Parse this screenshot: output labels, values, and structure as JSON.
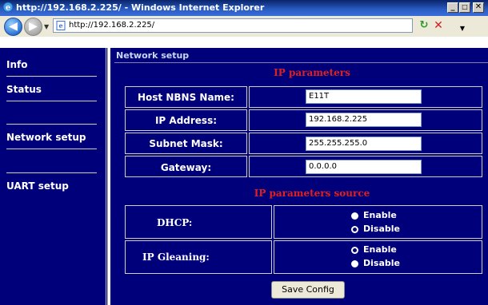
{
  "window": {
    "title": "http://192.168.2.225/ - Windows Internet Explorer",
    "address": "http://192.168.2.225/",
    "controls": {
      "minimize": "_",
      "maximize": "□",
      "close": "✕"
    }
  },
  "sidebar": {
    "items": [
      {
        "label": "Info"
      },
      {
        "label": "Status"
      },
      {
        "label": "Network setup"
      },
      {
        "label": "UART setup"
      }
    ]
  },
  "main": {
    "section_title": "Network setup",
    "ip_parameters": {
      "heading": "IP parameters",
      "rows": [
        {
          "label": "Host NBNS Name:",
          "value": "E11T"
        },
        {
          "label": "IP Address:",
          "value": "192.168.2.225"
        },
        {
          "label": "Subnet Mask:",
          "value": "255.255.255.0"
        },
        {
          "label": "Gateway:",
          "value": "0.0.0.0"
        }
      ]
    },
    "ip_source": {
      "heading": "IP parameters source",
      "rows": [
        {
          "label": "DHCP:",
          "options": [
            "Enable",
            "Disable"
          ],
          "selected": "Disable"
        },
        {
          "label": "IP Gleaning:",
          "options": [
            "Enable",
            "Disable"
          ],
          "selected": "Enable"
        }
      ]
    },
    "save_label": "Save Config"
  },
  "colors": {
    "page_bg": "#00007a",
    "heading_red": "#e02020",
    "titlebar": "#0a246a"
  }
}
